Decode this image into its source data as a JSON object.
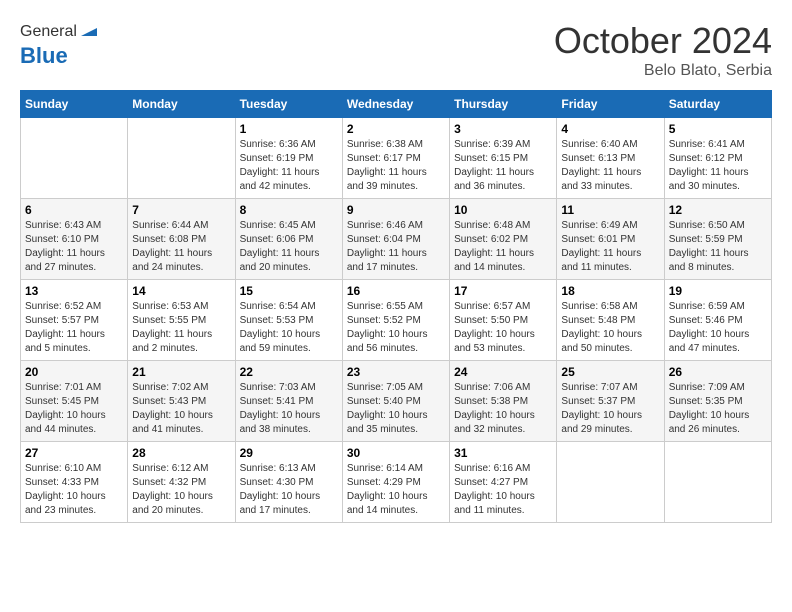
{
  "header": {
    "logo_general": "General",
    "logo_blue": "Blue",
    "month_title": "October 2024",
    "location": "Belo Blato, Serbia"
  },
  "days_of_week": [
    "Sunday",
    "Monday",
    "Tuesday",
    "Wednesday",
    "Thursday",
    "Friday",
    "Saturday"
  ],
  "weeks": [
    [
      {
        "day": "",
        "info": ""
      },
      {
        "day": "",
        "info": ""
      },
      {
        "day": "1",
        "info": "Sunrise: 6:36 AM\nSunset: 6:19 PM\nDaylight: 11 hours and 42 minutes."
      },
      {
        "day": "2",
        "info": "Sunrise: 6:38 AM\nSunset: 6:17 PM\nDaylight: 11 hours and 39 minutes."
      },
      {
        "day": "3",
        "info": "Sunrise: 6:39 AM\nSunset: 6:15 PM\nDaylight: 11 hours and 36 minutes."
      },
      {
        "day": "4",
        "info": "Sunrise: 6:40 AM\nSunset: 6:13 PM\nDaylight: 11 hours and 33 minutes."
      },
      {
        "day": "5",
        "info": "Sunrise: 6:41 AM\nSunset: 6:12 PM\nDaylight: 11 hours and 30 minutes."
      }
    ],
    [
      {
        "day": "6",
        "info": "Sunrise: 6:43 AM\nSunset: 6:10 PM\nDaylight: 11 hours and 27 minutes."
      },
      {
        "day": "7",
        "info": "Sunrise: 6:44 AM\nSunset: 6:08 PM\nDaylight: 11 hours and 24 minutes."
      },
      {
        "day": "8",
        "info": "Sunrise: 6:45 AM\nSunset: 6:06 PM\nDaylight: 11 hours and 20 minutes."
      },
      {
        "day": "9",
        "info": "Sunrise: 6:46 AM\nSunset: 6:04 PM\nDaylight: 11 hours and 17 minutes."
      },
      {
        "day": "10",
        "info": "Sunrise: 6:48 AM\nSunset: 6:02 PM\nDaylight: 11 hours and 14 minutes."
      },
      {
        "day": "11",
        "info": "Sunrise: 6:49 AM\nSunset: 6:01 PM\nDaylight: 11 hours and 11 minutes."
      },
      {
        "day": "12",
        "info": "Sunrise: 6:50 AM\nSunset: 5:59 PM\nDaylight: 11 hours and 8 minutes."
      }
    ],
    [
      {
        "day": "13",
        "info": "Sunrise: 6:52 AM\nSunset: 5:57 PM\nDaylight: 11 hours and 5 minutes."
      },
      {
        "day": "14",
        "info": "Sunrise: 6:53 AM\nSunset: 5:55 PM\nDaylight: 11 hours and 2 minutes."
      },
      {
        "day": "15",
        "info": "Sunrise: 6:54 AM\nSunset: 5:53 PM\nDaylight: 10 hours and 59 minutes."
      },
      {
        "day": "16",
        "info": "Sunrise: 6:55 AM\nSunset: 5:52 PM\nDaylight: 10 hours and 56 minutes."
      },
      {
        "day": "17",
        "info": "Sunrise: 6:57 AM\nSunset: 5:50 PM\nDaylight: 10 hours and 53 minutes."
      },
      {
        "day": "18",
        "info": "Sunrise: 6:58 AM\nSunset: 5:48 PM\nDaylight: 10 hours and 50 minutes."
      },
      {
        "day": "19",
        "info": "Sunrise: 6:59 AM\nSunset: 5:46 PM\nDaylight: 10 hours and 47 minutes."
      }
    ],
    [
      {
        "day": "20",
        "info": "Sunrise: 7:01 AM\nSunset: 5:45 PM\nDaylight: 10 hours and 44 minutes."
      },
      {
        "day": "21",
        "info": "Sunrise: 7:02 AM\nSunset: 5:43 PM\nDaylight: 10 hours and 41 minutes."
      },
      {
        "day": "22",
        "info": "Sunrise: 7:03 AM\nSunset: 5:41 PM\nDaylight: 10 hours and 38 minutes."
      },
      {
        "day": "23",
        "info": "Sunrise: 7:05 AM\nSunset: 5:40 PM\nDaylight: 10 hours and 35 minutes."
      },
      {
        "day": "24",
        "info": "Sunrise: 7:06 AM\nSunset: 5:38 PM\nDaylight: 10 hours and 32 minutes."
      },
      {
        "day": "25",
        "info": "Sunrise: 7:07 AM\nSunset: 5:37 PM\nDaylight: 10 hours and 29 minutes."
      },
      {
        "day": "26",
        "info": "Sunrise: 7:09 AM\nSunset: 5:35 PM\nDaylight: 10 hours and 26 minutes."
      }
    ],
    [
      {
        "day": "27",
        "info": "Sunrise: 6:10 AM\nSunset: 4:33 PM\nDaylight: 10 hours and 23 minutes."
      },
      {
        "day": "28",
        "info": "Sunrise: 6:12 AM\nSunset: 4:32 PM\nDaylight: 10 hours and 20 minutes."
      },
      {
        "day": "29",
        "info": "Sunrise: 6:13 AM\nSunset: 4:30 PM\nDaylight: 10 hours and 17 minutes."
      },
      {
        "day": "30",
        "info": "Sunrise: 6:14 AM\nSunset: 4:29 PM\nDaylight: 10 hours and 14 minutes."
      },
      {
        "day": "31",
        "info": "Sunrise: 6:16 AM\nSunset: 4:27 PM\nDaylight: 10 hours and 11 minutes."
      },
      {
        "day": "",
        "info": ""
      },
      {
        "day": "",
        "info": ""
      }
    ]
  ]
}
